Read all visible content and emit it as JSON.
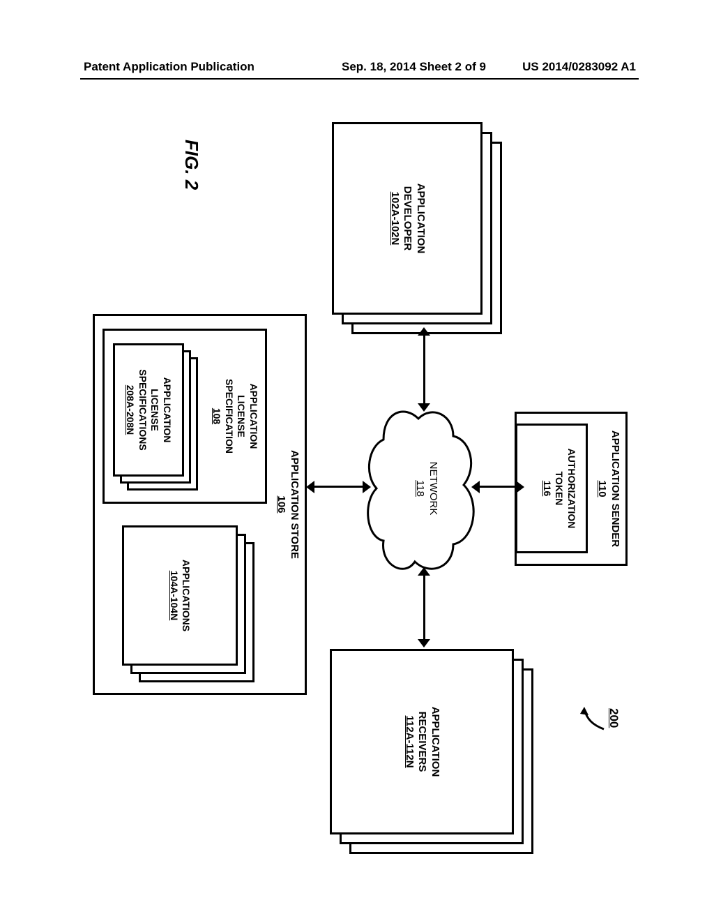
{
  "header": {
    "left": "Patent Application Publication",
    "mid": "Sep. 18, 2014  Sheet 2 of 9",
    "right": "US 2014/0283092 A1"
  },
  "fig": {
    "caption": "FIG. 2",
    "ref_num": "200",
    "app_sender": {
      "title": "APPLICATION SENDER",
      "num": "110",
      "token_title": "AUTHORIZATION TOKEN",
      "token_num": "116"
    },
    "developer": {
      "title": "APPLICATION DEVELOPER",
      "num": "102A-102N"
    },
    "receivers": {
      "title": "APPLICATION RECEIVERS",
      "num": "112A-112N"
    },
    "network": {
      "title": "NETWORK",
      "num": "118"
    },
    "store": {
      "title": "APPLICATION STORE",
      "num": "106",
      "apps": {
        "title": "APPLICATIONS",
        "num": "104A-104N"
      },
      "alspec_outer": {
        "title": "APPLICATION LICENSE SPECIFICATION",
        "num": "108"
      },
      "alspec_inner": {
        "title": "APPLICATION LICENSE SPECIFICATIONS",
        "num": "208A-208N"
      }
    }
  }
}
